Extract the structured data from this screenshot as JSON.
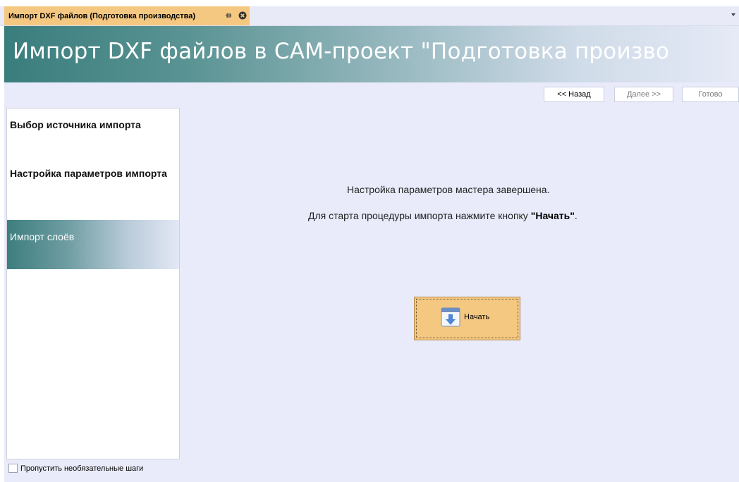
{
  "tab": {
    "title": "Импорт DXF файлов (Подготовка производства)"
  },
  "banner": {
    "title": "Импорт DXF файлов в CAM-проект \"Подготовка произво"
  },
  "nav": {
    "back_label": "<< Назад",
    "next_label": "Далее >>",
    "done_label": "Готово"
  },
  "steps": [
    {
      "label": "Выбор источника импорта",
      "active": false
    },
    {
      "label": "Настройка параметров импорта",
      "active": false
    },
    {
      "label": "Импорт слоёв",
      "active": true
    }
  ],
  "skip_optional": {
    "label": "Пропустить необязательные шаги",
    "checked": false
  },
  "content": {
    "message_1": "Настройка параметров мастера завершена.",
    "message_2_prefix": "Для старта процедуры импорта нажмите кнопку ",
    "message_2_bold": "\"Начать\"",
    "message_2_suffix": "."
  },
  "start_button": {
    "label": "Начать",
    "icon": "import-arrow-icon"
  },
  "colors": {
    "accent_tab": "#f5c882",
    "banner_teal": "#3a7d7d",
    "background": "#e9ebfa"
  }
}
